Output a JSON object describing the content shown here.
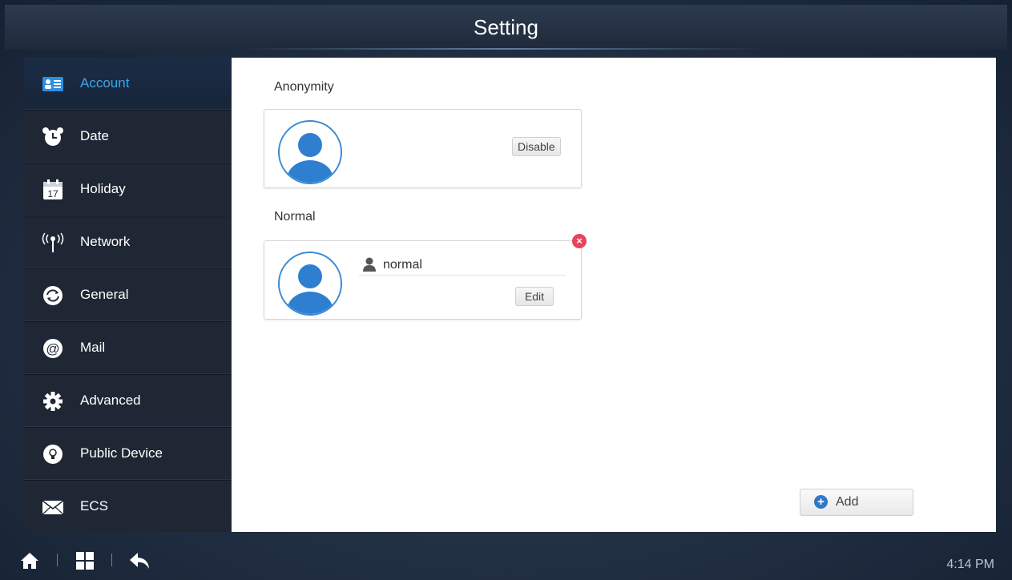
{
  "header": {
    "title": "Setting"
  },
  "sidebar": {
    "items": [
      {
        "label": "Account",
        "icon": "account-card-icon",
        "active": true
      },
      {
        "label": "Date",
        "icon": "alarm-clock-icon"
      },
      {
        "label": "Holiday",
        "icon": "calendar-icon"
      },
      {
        "label": "Network",
        "icon": "antenna-icon"
      },
      {
        "label": "General",
        "icon": "sync-icon"
      },
      {
        "label": "Mail",
        "icon": "at-sign-icon"
      },
      {
        "label": "Advanced",
        "icon": "gear-icon"
      },
      {
        "label": "Public Device",
        "icon": "bulb-icon"
      },
      {
        "label": "ECS",
        "icon": "envelope-icon"
      }
    ]
  },
  "main": {
    "anonymity": {
      "title": "Anonymity",
      "button_label": "Disable"
    },
    "normal": {
      "title": "Normal",
      "username": "normal",
      "edit_label": "Edit"
    },
    "add_label": "Add"
  },
  "footer": {
    "time": "4:14 PM"
  },
  "colors": {
    "accent": "#3aa6ec",
    "avatar_blue": "#2f7fd1",
    "delete_red": "#e8435a"
  }
}
